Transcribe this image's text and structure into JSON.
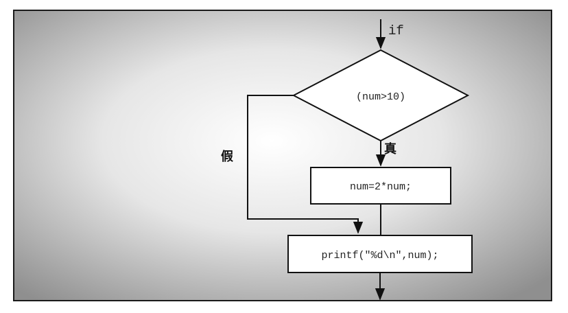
{
  "flowchart": {
    "entry_label": "if",
    "condition": "(num>10)",
    "true_label": "真",
    "false_label": "假",
    "true_statement": "num=2*num;",
    "next_statement": "printf(\"%d\\n\",num);"
  },
  "colors": {
    "frame_border": "#1a1a1a",
    "background_center": "#ffffff",
    "background_edge": "#8f8f8f",
    "shape_fill": "#ffffff",
    "stroke": "#111111"
  }
}
